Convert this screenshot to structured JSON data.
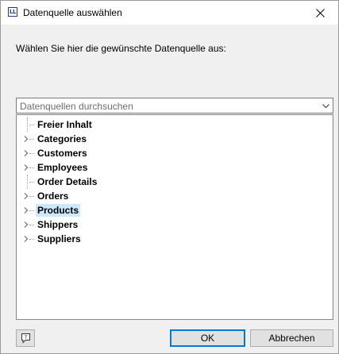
{
  "window": {
    "title": "Datenquelle auswählen",
    "icon_name": "ll-app-icon",
    "icon_text": "LL"
  },
  "prompt": "Wählen Sie hier die gewünschte Datenquelle aus:",
  "search": {
    "placeholder": "Datenquellen durchsuchen"
  },
  "tree": {
    "items": [
      {
        "label": "Freier Inhalt",
        "expandable": false,
        "selected": false
      },
      {
        "label": "Categories",
        "expandable": true,
        "selected": false
      },
      {
        "label": "Customers",
        "expandable": true,
        "selected": false
      },
      {
        "label": "Employees",
        "expandable": true,
        "selected": false
      },
      {
        "label": "Order Details",
        "expandable": false,
        "selected": false
      },
      {
        "label": "Orders",
        "expandable": true,
        "selected": false
      },
      {
        "label": "Products",
        "expandable": true,
        "selected": true
      },
      {
        "label": "Shippers",
        "expandable": true,
        "selected": false
      },
      {
        "label": "Suppliers",
        "expandable": true,
        "selected": false
      }
    ]
  },
  "buttons": {
    "ok": "OK",
    "cancel": "Abbrechen",
    "help_icon": "help-icon"
  },
  "colors": {
    "selection": "#cce8ff",
    "default_button_border": "#0078d7",
    "dialog_background": "#f0f0f0"
  }
}
